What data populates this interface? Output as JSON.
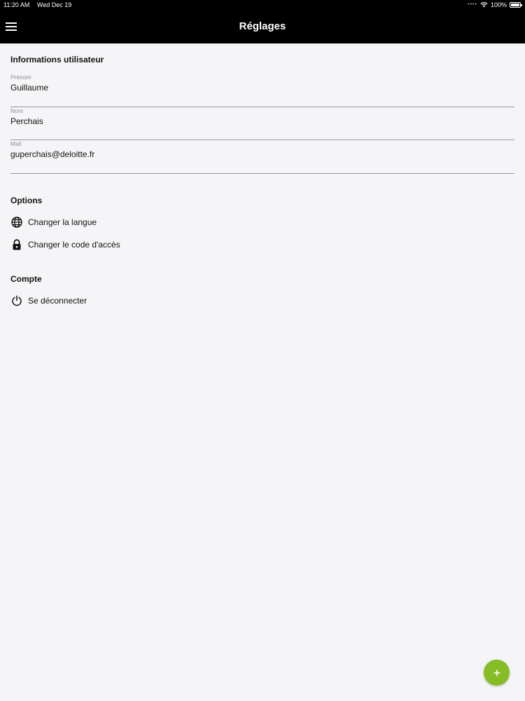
{
  "status_bar": {
    "time": "11:20 AM",
    "date": "Wed Dec 19",
    "battery": "100%",
    "battery_level": 1.0
  },
  "nav": {
    "title": "Réglages",
    "menu_icon": "hamburger-menu-icon"
  },
  "user_info": {
    "section_title": "Informations utilisateur",
    "fields": [
      {
        "label": "Prénom",
        "value": "Guillaume"
      },
      {
        "label": "Nom",
        "value": "Perchais"
      },
      {
        "label": "Mail",
        "value": "guperchais@deloitte.fr"
      }
    ]
  },
  "options": {
    "section_title": "Options",
    "items": [
      {
        "label": "Changer la langue",
        "icon": "globe-icon"
      },
      {
        "label": "Changer le code d'accès",
        "icon": "lock-icon"
      }
    ]
  },
  "account": {
    "section_title": "Compte",
    "items": [
      {
        "label": "Se déconnecter",
        "icon": "power-icon"
      }
    ]
  },
  "fab": {
    "label": "+",
    "color": "#86bc25"
  }
}
